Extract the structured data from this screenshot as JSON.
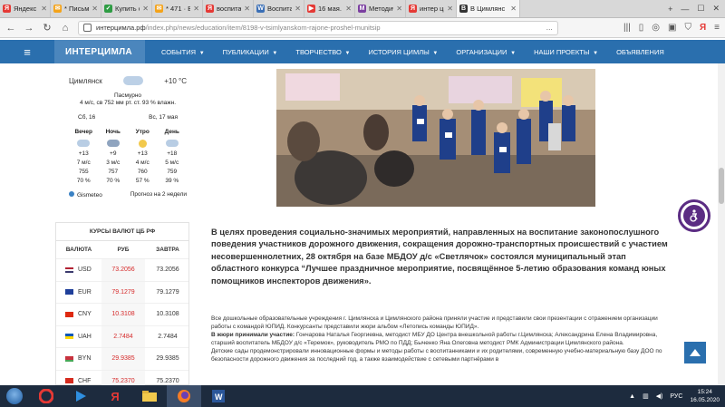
{
  "browser": {
    "tabs": [
      {
        "label": "Яндекс",
        "fav_color": "#e53935",
        "fav_glyph": "Я"
      },
      {
        "label": "* Письмо «Го",
        "fav_color": "#f4a31a",
        "fav_glyph": "✉"
      },
      {
        "label": "Купить соко",
        "fav_color": "#2e9c43",
        "fav_glyph": "✓"
      },
      {
        "label": "* 471 · Входящ",
        "fav_color": "#f4a31a",
        "fav_glyph": "✉"
      },
      {
        "label": "воспитател",
        "fav_color": "#e53935",
        "fav_glyph": "Я"
      },
      {
        "label": "Воспитате",
        "fav_color": "#3b6fb6",
        "fav_glyph": "W"
      },
      {
        "label": "16 мая. PC",
        "fav_color": "#e53935",
        "fav_glyph": "▶"
      },
      {
        "label": "Методическ",
        "fav_color": "#7b3fa0",
        "fav_glyph": "M"
      },
      {
        "label": "интер цимл",
        "fav_color": "#e53935",
        "fav_glyph": "Я"
      },
      {
        "label": "В Цимлянс",
        "fav_color": "#333333",
        "fav_glyph": "В",
        "active": true
      }
    ],
    "url_host": "интерцимла.рф",
    "url_path": "/index.php/news/education/item/8198-v-tsimlyanskom-rajone-proshel-munitsip",
    "url_more": "…"
  },
  "site": {
    "brand": "ИНТЕРЦИМЛА",
    "menu": [
      {
        "label": "СОБЫТИЯ",
        "dropdown": true
      },
      {
        "label": "ПУБЛИКАЦИИ",
        "dropdown": true
      },
      {
        "label": "ТВОРЧЕСТВО",
        "dropdown": true
      },
      {
        "label": "ИСТОРИЯ ЦИМЛЫ",
        "dropdown": true
      },
      {
        "label": "ОРГАНИЗАЦИИ",
        "dropdown": true
      },
      {
        "label": "НАШИ ПРОЕКТЫ",
        "dropdown": true
      },
      {
        "label": "ОБЪЯВЛЕНИЯ",
        "dropdown": false
      }
    ],
    "nav_color": "#2a6fae"
  },
  "weather": {
    "city": "Цимлянск",
    "temp": "+10 °C",
    "desc": "Пасмурно",
    "details": "4 м/с, св   752 мм рт. ст.   93 % влажн.",
    "day_labels": [
      "Сб, 16",
      "Вс, 17 мая"
    ],
    "periods": [
      "Вечер",
      "Ночь",
      "Утро",
      "День"
    ],
    "temps": [
      "+13",
      "+9",
      "+13",
      "+18"
    ],
    "winds": [
      "7 м/с",
      "3 м/с",
      "4 м/с",
      "5 м/с"
    ],
    "pressures": [
      "755",
      "757",
      "760",
      "759"
    ],
    "humidity": [
      "70 %",
      "70 %",
      "57 %",
      "39 %"
    ],
    "source": "Gismeteo",
    "forecast_link": "Прогноз на 2 недели"
  },
  "currency": {
    "title": "КУРСЫ ВАЛЮТ ЦБ РФ",
    "headers": [
      "ВАЛЮТА",
      "РУБ",
      "ЗАВТРА"
    ],
    "rows": [
      {
        "code": "USD",
        "rub": "73.2056",
        "tomorrow": "73.2056"
      },
      {
        "code": "EUR",
        "rub": "79.1279",
        "tomorrow": "79.1279"
      },
      {
        "code": "CNY",
        "rub": "10.3108",
        "tomorrow": "10.3108"
      },
      {
        "code": "UAH",
        "rub": "2.7484",
        "tomorrow": "2.7484"
      },
      {
        "code": "BYN",
        "rub": "29.9385",
        "tomorrow": "29.9385"
      },
      {
        "code": "CHF",
        "rub": "75.2370",
        "tomorrow": "75.2370"
      }
    ]
  },
  "article": {
    "headline": "В целях проведения социально-значимых мероприятий, направленных на воспитание законопослушного поведения участников дорожного движения, сокращения дорожно-транспортных происшествий с участием несовершеннолетних, 28 октября на базе МБДОУ д/с «Светлячок» состоялся муниципальный этап областного конкурса “Лучшее праздничное мероприятие, посвящённое 5-летию образования команд юных помощников инспекторов движения».",
    "p1": "Все дошкольные образовательные учреждения г. Цимлянска и Цимлянского района приняли участие и представили свои презентации с отражением организации работы с командой ЮПИД. Конкурсанты представили жюри альбом «Летопись команды ЮПИД».",
    "jury_label": "В жюри принимали участие:",
    "jury_text": " Гончарова Наталья Георгиевна, методист МБУ ДО Центра внешкольной работы г.Цимлянска; Александрина Елена Владимировна, старший воспитатель МБДОУ д/с «Теремок», руководитель РМО по ПДД; Быченко Яна Олеговна методист РМК Администрации Цимлянского района.",
    "p3": "Детские сады продемонстрировали инновационные формы и методы работы с воспитанниками и их родителями, современную учебно-материальную базу ДОО по безопасности дорожного движения за последний год, а также взаимодействие с сетевыми партнёрами в"
  },
  "taskbar": {
    "lang": "РУС",
    "time": "15:24",
    "date": "16.05.2020"
  }
}
